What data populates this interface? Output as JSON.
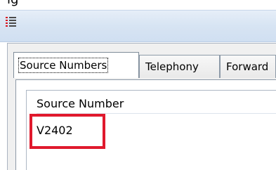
{
  "top_crop_text": "ig",
  "window": {
    "icon": "list-icon"
  },
  "tabs": [
    {
      "label": "Source Numbers",
      "active": true
    },
    {
      "label": "Telephony",
      "active": false
    },
    {
      "label": "Forward",
      "active": false
    }
  ],
  "grid": {
    "column_header": "Source Number",
    "rows": [
      {
        "value": "V2402"
      }
    ]
  },
  "colors": {
    "highlight": "#e0192d",
    "titlebar": "#d7e4f3"
  }
}
